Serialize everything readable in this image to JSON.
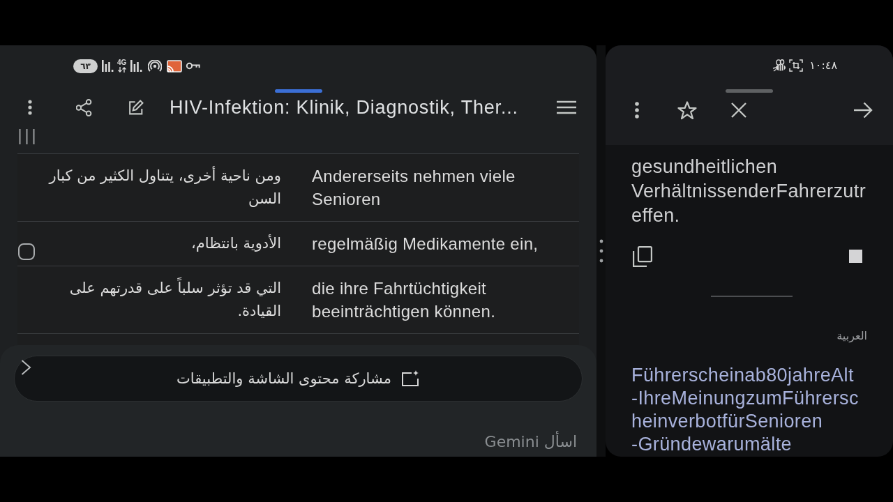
{
  "left_panel": {
    "status_bar": {
      "battery": "٦٣",
      "network_type": "4G"
    },
    "toolbar": {
      "title": "HIV-Infektion: Klinik, Diagnostik, Ther..."
    },
    "table": {
      "rows": [
        {
          "arabic": "ومن ناحية أخرى، يتناول الكثير من كبار السن",
          "german": "Andererseits nehmen viele Senioren"
        },
        {
          "arabic": "الأدوية بانتظام،",
          "german": "regelmäßig Medikamente ein,"
        },
        {
          "arabic": "التي قد تؤثر سلباً على قدرتهم على القيادة.",
          "german": "die ihre Fahrtüchtigkeit beeinträchtigen können."
        }
      ]
    },
    "share_chip": {
      "label": "مشاركة محتوى الشاشة والتطبيقات"
    },
    "prompt_field": {
      "placeholder": "اسأل Gemini"
    }
  },
  "right_panel": {
    "status_bar": {
      "time": "١٠:٤٨"
    },
    "translation": {
      "lines": [
        "gesundheitlichen",
        "VerhältnissenderFahrerzutr",
        "effen."
      ]
    },
    "source_language": "العربية",
    "source_text": {
      "lines": [
        "Führerscheinab80jahreAlt",
        "-IhreMeinungzumFührersc",
        "heinverbotfürSenioren",
        "-Gründewarumälte"
      ]
    }
  }
}
